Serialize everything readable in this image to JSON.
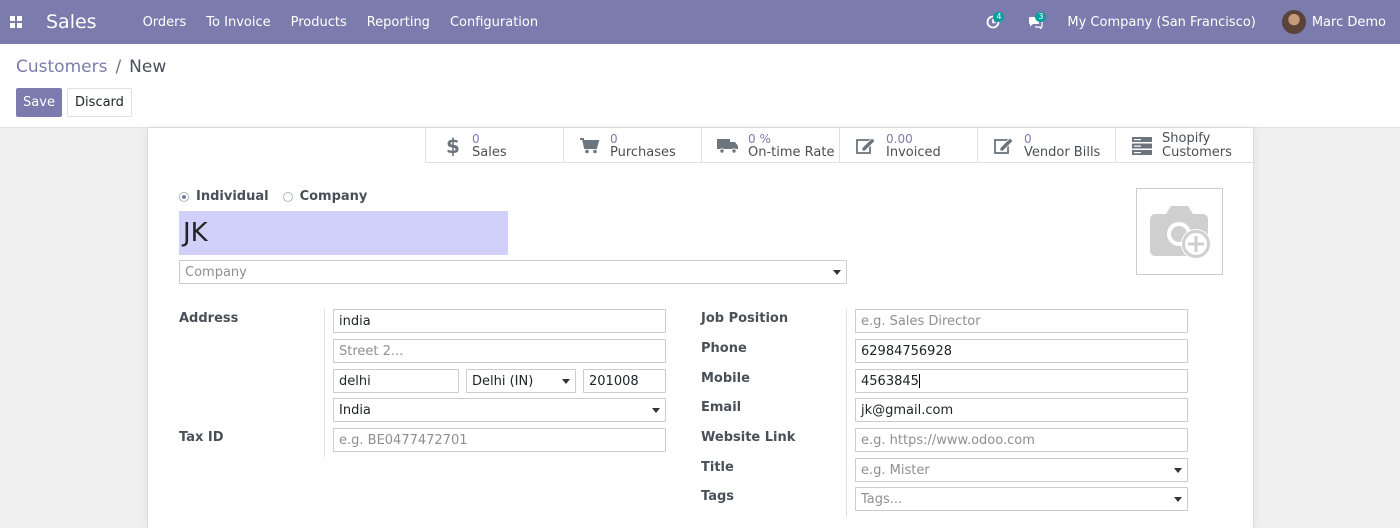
{
  "navbar": {
    "app_name": "Sales",
    "menu": [
      "Orders",
      "To Invoice",
      "Products",
      "Reporting",
      "Configuration"
    ],
    "activity_count": "4",
    "message_count": "3",
    "company": "My Company (San Francisco)",
    "user": "Marc Demo",
    "color": "#7c7bad"
  },
  "breadcrumb": {
    "parent": "Customers",
    "separator": "/",
    "current": "New"
  },
  "buttons": {
    "save": "Save",
    "discard": "Discard"
  },
  "stat_buttons": [
    {
      "icon": "dollar-icon",
      "value": "0",
      "label": "Sales"
    },
    {
      "icon": "cart-icon",
      "value": "0",
      "label": "Purchases"
    },
    {
      "icon": "truck-icon",
      "value": "0 %",
      "label": "On-time Rate"
    },
    {
      "icon": "edit-icon",
      "value": "0.00",
      "label": "Invoiced"
    },
    {
      "icon": "edit-icon",
      "value": "0",
      "label": "Vendor Bills"
    },
    {
      "icon": "server-icon",
      "value": "Shopify",
      "label": "Customers"
    }
  ],
  "form": {
    "type_options": {
      "individual": "Individual",
      "company": "Company",
      "selected": "Individual"
    },
    "name": "JK",
    "company_placeholder": "Company",
    "labels": {
      "address": "Address",
      "tax_id": "Tax ID",
      "job_position": "Job Position",
      "phone": "Phone",
      "mobile": "Mobile",
      "email": "Email",
      "website": "Website Link",
      "title": "Title",
      "tags": "Tags"
    },
    "street": "india",
    "street2_placeholder": "Street 2...",
    "city": "delhi",
    "state": "Delhi (IN)",
    "zip": "201008",
    "country": "India",
    "tax_id_placeholder": "e.g. BE0477472701",
    "job_position_placeholder": "e.g. Sales Director",
    "phone": "62984756928",
    "mobile": "4563845",
    "email": "jk@gmail.com",
    "website_placeholder": "e.g. https://www.odoo.com",
    "title_placeholder": "e.g. Mister",
    "tags_placeholder": "Tags..."
  }
}
